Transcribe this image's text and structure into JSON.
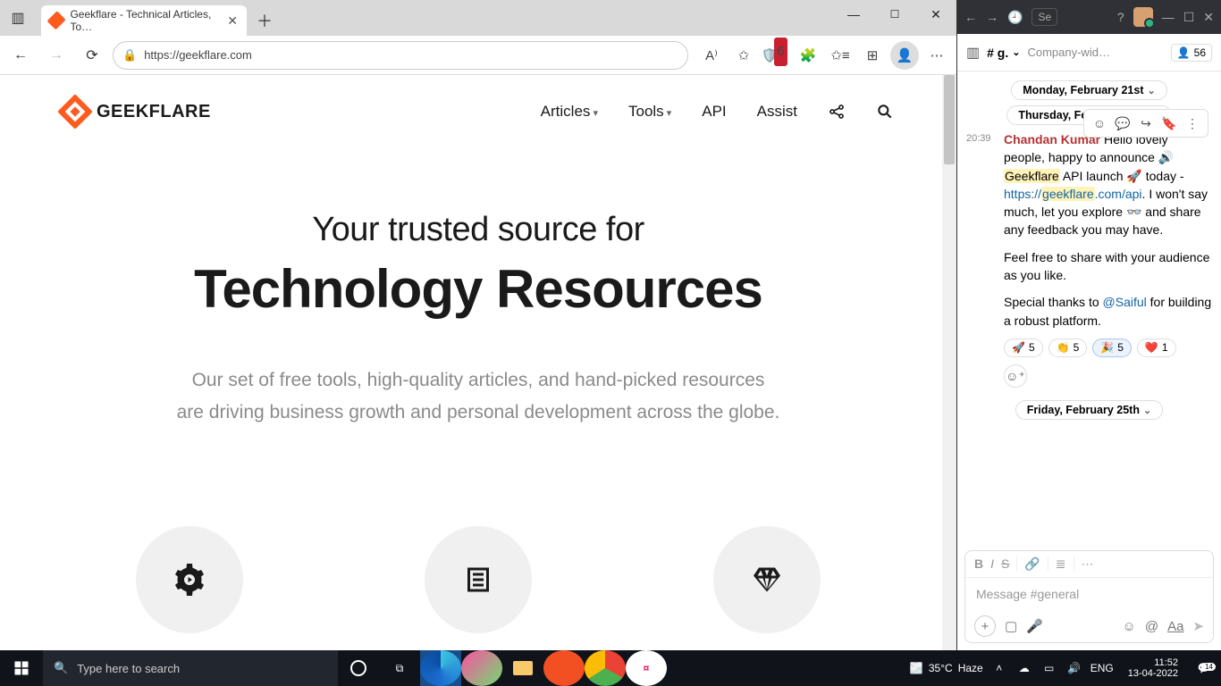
{
  "browser": {
    "tab_title": "Geekflare - Technical Articles, To…",
    "url": "https://geekflare.com",
    "shield_badge": "6"
  },
  "geekflare": {
    "brand": "GEEKFLARE",
    "nav": {
      "articles": "Articles",
      "tools": "Tools",
      "api": "API",
      "assist": "Assist"
    },
    "hero_line1": "Your trusted source for",
    "hero_line2": "Technology Resources",
    "hero_sub1": "Our set of free tools, high-quality articles, and hand-picked resources",
    "hero_sub2": "are driving business growth and personal development across the globe."
  },
  "slack": {
    "channel_short": "# g.",
    "topic": "Company-wid…",
    "member_count": "56",
    "dates": {
      "mon": "Monday, February 21st",
      "thu": "Thursday, February 24th",
      "fri": "Friday, February 25th"
    },
    "msg": {
      "time": "20:39",
      "author": "Chandan Kumar",
      "t1a": " Hello lovely people, happy to announce 🔊 ",
      "hl1": "Geekflare",
      "t1b": " API launch 🚀 today - ",
      "link_pre": "https://",
      "link_hl": "geekflare",
      "link_post": ".com/api",
      "t1c": ". I won't say much, let you explore 👓 and share any feedback you may have.",
      "p2": "Feel free to share with your audience as you like.",
      "p3a": "Special thanks to ",
      "mention": "@Saiful",
      "p3b": " for building a robust platform."
    },
    "reactions": {
      "rocket": "5",
      "clap": "5",
      "party": "5",
      "heart": "1"
    },
    "composer_placeholder": "Message #general"
  },
  "taskbar": {
    "search_placeholder": "Type here to search",
    "weather_temp": "35°C",
    "weather_label": "Haze",
    "lang": "ENG",
    "time": "11:52",
    "date": "13-04-2022",
    "notif_count": "14"
  }
}
